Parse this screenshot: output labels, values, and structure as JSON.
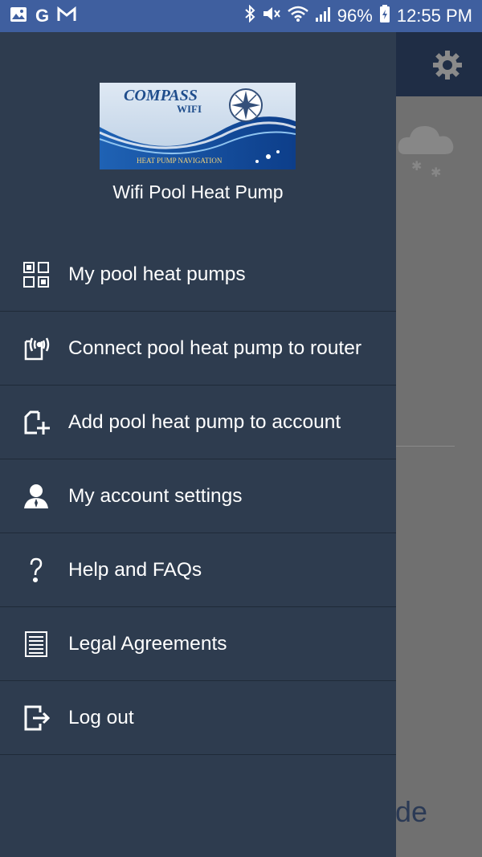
{
  "status_bar": {
    "battery": "96%",
    "time": "12:55 PM"
  },
  "background": {
    "partial_text": "de"
  },
  "drawer": {
    "app_name": "Wifi Pool Heat Pump",
    "logo": {
      "title": "COMPASS",
      "subtitle": "WIFI",
      "tagline": "HEAT PUMP NAVIGATION"
    },
    "menu_items": [
      {
        "label": "My pool heat pumps",
        "icon": "qr-grid-icon"
      },
      {
        "label": "Connect pool heat pump to router",
        "icon": "router-signal-icon"
      },
      {
        "label": "Add pool heat pump to account",
        "icon": "add-device-icon"
      },
      {
        "label": "My account settings",
        "icon": "person-icon"
      },
      {
        "label": "Help and FAQs",
        "icon": "question-icon"
      },
      {
        "label": "Legal Agreements",
        "icon": "document-icon"
      },
      {
        "label": "Log out",
        "icon": "logout-icon"
      }
    ]
  },
  "colors": {
    "status_bar": "#3f5f9f",
    "drawer_bg": "#2e3c4f",
    "toolbar_bg": "#1f2d45",
    "scrim": "#707070"
  }
}
